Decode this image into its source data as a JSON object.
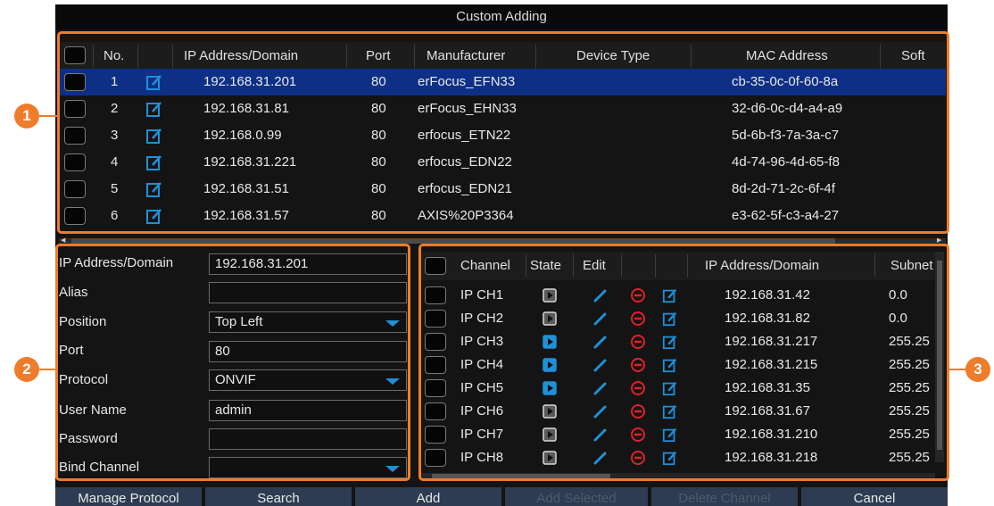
{
  "window": {
    "title": "Custom Adding"
  },
  "device_table": {
    "columns": [
      "No.",
      "IP Address/Domain",
      "Port",
      "Manufacturer",
      "Device Type",
      "MAC Address",
      "Soft"
    ],
    "rows": [
      {
        "no": "1",
        "ip": "192.168.31.201",
        "port": "80",
        "manufacturer": "erFocus_EFN33",
        "device_type": "",
        "mac": "cb-35-0c-0f-60-8a",
        "selected": true
      },
      {
        "no": "2",
        "ip": "192.168.31.81",
        "port": "80",
        "manufacturer": "erFocus_EHN33",
        "device_type": "",
        "mac": "32-d6-0c-d4-a4-a9",
        "selected": false
      },
      {
        "no": "3",
        "ip": "192.168.0.99",
        "port": "80",
        "manufacturer": "erfocus_ETN22",
        "device_type": "",
        "mac": "5d-6b-f3-7a-3a-c7",
        "selected": false
      },
      {
        "no": "4",
        "ip": "192.168.31.221",
        "port": "80",
        "manufacturer": "erfocus_EDN22",
        "device_type": "",
        "mac": "4d-74-96-4d-65-f8",
        "selected": false
      },
      {
        "no": "5",
        "ip": "192.168.31.51",
        "port": "80",
        "manufacturer": "erfocus_EDN21",
        "device_type": "",
        "mac": "8d-2d-71-2c-6f-4f",
        "selected": false
      },
      {
        "no": "6",
        "ip": "192.168.31.57",
        "port": "80",
        "manufacturer": "AXIS%20P3364",
        "device_type": "",
        "mac": "e3-62-5f-c3-a4-27",
        "selected": false
      }
    ]
  },
  "form": {
    "ip_label": "IP Address/Domain",
    "ip_value": "192.168.31.201",
    "alias_label": "Alias",
    "alias_value": "",
    "position_label": "Position",
    "position_value": "Top Left",
    "port_label": "Port",
    "port_value": "80",
    "protocol_label": "Protocol",
    "protocol_value": "ONVIF",
    "username_label": "User Name",
    "username_value": "admin",
    "password_label": "Password",
    "password_value": "",
    "bind_label": "Bind Channel",
    "bind_value": ""
  },
  "channel_table": {
    "columns": [
      "Channel",
      "State",
      "Edit",
      "IP Address/Domain",
      "Subnet"
    ],
    "rows": [
      {
        "channel": "IP CH1",
        "state": "idle",
        "ip": "192.168.31.42",
        "subnet": "0.0"
      },
      {
        "channel": "IP CH2",
        "state": "idle",
        "ip": "192.168.31.82",
        "subnet": "0.0"
      },
      {
        "channel": "IP CH3",
        "state": "active",
        "ip": "192.168.31.217",
        "subnet": "255.25"
      },
      {
        "channel": "IP CH4",
        "state": "active",
        "ip": "192.168.31.215",
        "subnet": "255.25"
      },
      {
        "channel": "IP CH5",
        "state": "active",
        "ip": "192.168.31.35",
        "subnet": "255.25"
      },
      {
        "channel": "IP CH6",
        "state": "idle",
        "ip": "192.168.31.67",
        "subnet": "255.25"
      },
      {
        "channel": "IP CH7",
        "state": "idle",
        "ip": "192.168.31.210",
        "subnet": "255.25"
      },
      {
        "channel": "IP CH8",
        "state": "idle",
        "ip": "192.168.31.218",
        "subnet": "255.25"
      }
    ]
  },
  "buttons": {
    "manage_protocol": "Manage Protocol",
    "search": "Search",
    "add": "Add",
    "add_selected": "Add Selected",
    "delete_channel": "Delete Channel",
    "cancel": "Cancel"
  },
  "callouts": {
    "one": "1",
    "two": "2",
    "three": "3"
  },
  "colors": {
    "highlight": "#0d2f86",
    "accent": "#ee7c2b",
    "icon_blue": "#1e90d8",
    "delete_red": "#e0202a",
    "button_bg": "#2d3c52"
  },
  "icons": {
    "edit": "edit-icon",
    "state": "play-state-icon",
    "delete": "delete-icon",
    "pencil": "pencil-icon",
    "dropdown": "dropdown-arrow-icon"
  }
}
